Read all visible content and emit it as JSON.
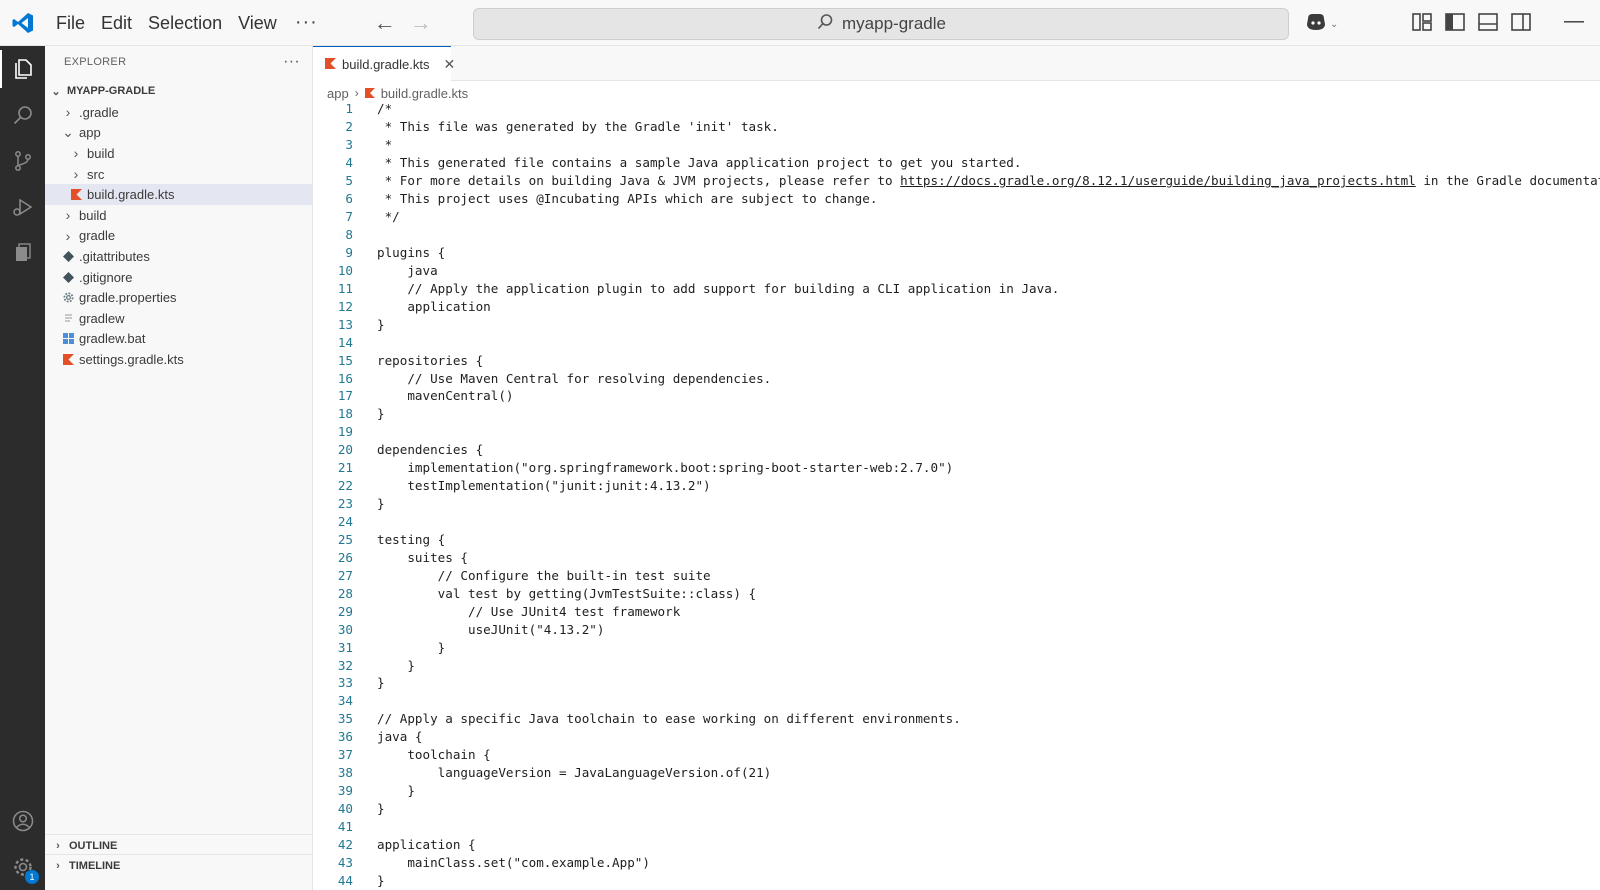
{
  "titlebar": {
    "menu": [
      "File",
      "Edit",
      "Selection",
      "View"
    ],
    "more": "···",
    "search": "myapp-gradle",
    "minimize": "—"
  },
  "sidebar": {
    "header": "EXPLORER",
    "root": "MYAPP-GRADLE",
    "items": [
      {
        "label": ".gradle",
        "indent": 0,
        "type": "folder",
        "open": false
      },
      {
        "label": "app",
        "indent": 0,
        "type": "folder",
        "open": true
      },
      {
        "label": "build",
        "indent": 1,
        "type": "folder",
        "open": false
      },
      {
        "label": "src",
        "indent": 1,
        "type": "folder",
        "open": false
      },
      {
        "label": "build.gradle.kts",
        "indent": 1,
        "type": "kotlin-file",
        "selected": true
      },
      {
        "label": "build",
        "indent": 0,
        "type": "folder",
        "open": false
      },
      {
        "label": "gradle",
        "indent": 0,
        "type": "folder",
        "open": false
      },
      {
        "label": ".gitattributes",
        "indent": 0,
        "type": "git-file"
      },
      {
        "label": ".gitignore",
        "indent": 0,
        "type": "git-file"
      },
      {
        "label": "gradle.properties",
        "indent": 0,
        "type": "gear-file"
      },
      {
        "label": "gradlew",
        "indent": 0,
        "type": "text-file"
      },
      {
        "label": "gradlew.bat",
        "indent": 0,
        "type": "windows-file"
      },
      {
        "label": "settings.gradle.kts",
        "indent": 0,
        "type": "kotlin-file"
      }
    ],
    "outline": "OUTLINE",
    "timeline": "TIMELINE"
  },
  "activity": {
    "badge": "1"
  },
  "editor": {
    "tab": "build.gradle.kts",
    "breadcrumb": [
      "app",
      "build.gradle.kts"
    ],
    "lines": [
      "/*",
      " * This file was generated by the Gradle 'init' task.",
      " *",
      " * This generated file contains a sample Java application project to get you started.",
      " * For more details on building Java & JVM projects, please refer to ",
      " * This project uses @Incubating APIs which are subject to change.",
      " */",
      "",
      "plugins {",
      "    java",
      "    // Apply the application plugin to add support for building a CLI application in Java.",
      "    application",
      "}",
      "",
      "repositories {",
      "    // Use Maven Central for resolving dependencies.",
      "    mavenCentral()",
      "}",
      "",
      "dependencies {",
      "    implementation(\"org.springframework.boot:spring-boot-starter-web:2.7.0\")",
      "    testImplementation(\"junit:junit:4.13.2\")",
      "}",
      "",
      "testing {",
      "    suites {",
      "        // Configure the built-in test suite",
      "        val test by getting(JvmTestSuite::class) {",
      "            // Use JUnit4 test framework",
      "            useJUnit(\"4.13.2\")",
      "        }",
      "    }",
      "}",
      "",
      "// Apply a specific Java toolchain to ease working on different environments.",
      "java {",
      "    toolchain {",
      "        languageVersion = JavaLanguageVersion.of(21)",
      "    }",
      "}",
      "",
      "application {",
      "    mainClass.set(\"com.example.App\")",
      "}"
    ],
    "line5_link": "https://docs.gradle.org/8.12.1/userguide/building_java_projects.html",
    "line5_tail": " in the Gradle documentation."
  },
  "colors": {
    "accent": "#005fb8",
    "activitybar": "#2c2c2c",
    "kotlin": "#e44857",
    "line_number": "#237893"
  }
}
